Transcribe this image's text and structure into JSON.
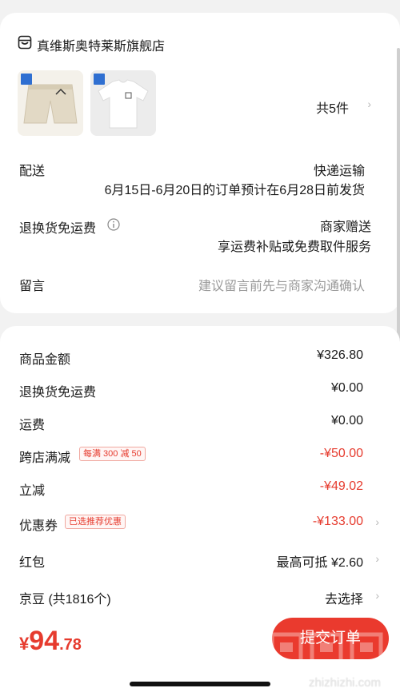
{
  "store": {
    "name": "真维斯奥特莱斯旗舰店",
    "icon": "store-icon"
  },
  "items": {
    "count_label": "共5件",
    "chevron": "›"
  },
  "delivery": {
    "label": "配送",
    "method": "快递运输",
    "note": "6月15日-6月20日的订单预计在6月28日前发货"
  },
  "return_shipping": {
    "label": "退换货免运费",
    "value": "商家赠送",
    "desc": "享运费补贴或免费取件服务",
    "info_icon": "info-icon"
  },
  "message": {
    "label": "留言",
    "placeholder": "建议留言前先与商家沟通确认"
  },
  "price_rows": [
    {
      "label": "商品金额",
      "value": "¥326.80"
    },
    {
      "label": "退换货免运费",
      "value": "¥0.00"
    },
    {
      "label": "运费",
      "value": "¥0.00"
    },
    {
      "label": "跨店满减",
      "badge": "每满 300 减 50",
      "value": "-¥50.00"
    },
    {
      "label": "立减",
      "value": "-¥49.02"
    },
    {
      "label": "优惠券",
      "badge": "已选推荐优惠",
      "value": "-¥133.00"
    },
    {
      "label": "红包",
      "value": "最高可抵 ¥2.60"
    },
    {
      "label": "京豆 (共1816个)",
      "value": "去选择"
    }
  ],
  "bottom": {
    "currency": "¥",
    "total_int": "94",
    "total_dec": ".78",
    "submit_label": "提交订单"
  },
  "watermark": {
    "text": "zhizhizhi.com"
  },
  "colors": {
    "accent": "#e63b2e",
    "button": "#ea3a2e",
    "badge_border": "#f0a79f"
  }
}
